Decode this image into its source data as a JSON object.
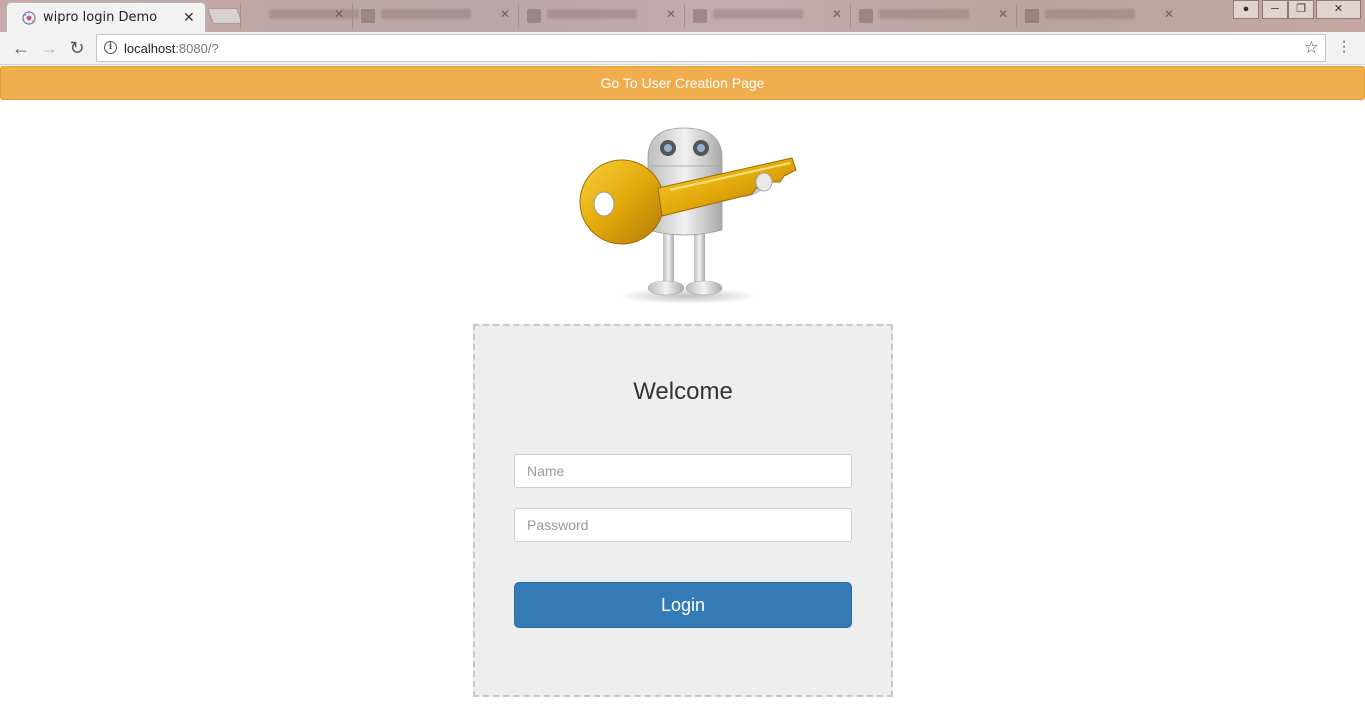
{
  "browser": {
    "active_tab_title": "wipro login Demo",
    "address_host": "localhost",
    "address_rest": ":8080/?",
    "icons": {
      "back": "arrow-left-icon",
      "forward": "arrow-right-icon",
      "reload": "reload-icon",
      "info": "info-icon",
      "bookmark": "star-icon",
      "menu": "kebab-menu-icon"
    }
  },
  "banner": {
    "label": "Go To User Creation Page",
    "color": "#f0ad4e"
  },
  "login": {
    "heading": "Welcome",
    "name_placeholder": "Name",
    "password_placeholder": "Password",
    "button_label": "Login",
    "button_color": "#337ab7"
  }
}
